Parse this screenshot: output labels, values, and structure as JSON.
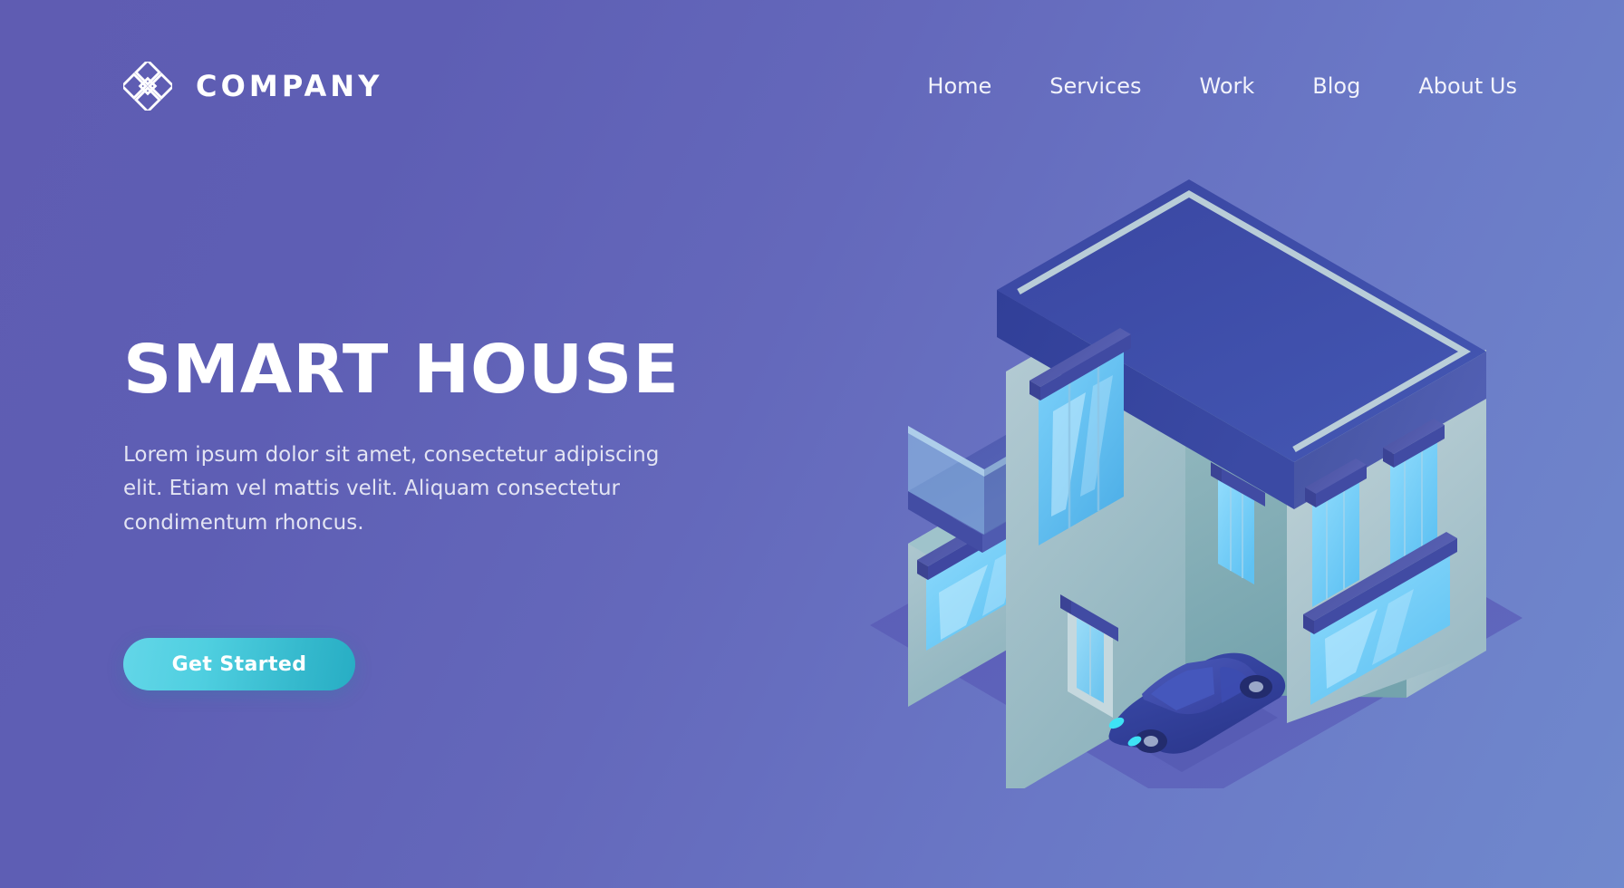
{
  "header": {
    "logo_icon": "diamond-lattice-logo-icon",
    "brand_name": "COMPANY",
    "nav_items": [
      {
        "label": "Home"
      },
      {
        "label": "Services"
      },
      {
        "label": "Work"
      },
      {
        "label": "Blog"
      },
      {
        "label": "About Us"
      }
    ]
  },
  "hero": {
    "headline": "SMART HOUSE",
    "subcopy": "Lorem ipsum dolor sit amet, consectetur adipiscing elit. Etiam vel mattis velit. Aliquam consectetur condimentum rhoncus.",
    "cta_label": "Get Started"
  },
  "illustration": {
    "name": "isometric-smart-house-illustration",
    "elements": [
      "ground-plane",
      "house-building",
      "balcony",
      "roof",
      "windows",
      "door",
      "parked-car"
    ]
  },
  "colors": {
    "background_start": "#5f5cb2",
    "background_end": "#7089cd",
    "cta_gradient_start": "#63d6e8",
    "cta_gradient_end": "#27adc4",
    "text_primary": "#ffffff",
    "text_secondary": "#e3e4f3",
    "ground_plane": "#5c5fb8",
    "roof_dark": "#3b49a3",
    "wall_light": "#b8cdd6",
    "wall_shadow": "#7fa7b4",
    "window_glass": "#76d2fb",
    "awning": "#4a51a8",
    "car_body": "#2f3d99",
    "headlight": "#3ee2f5"
  }
}
